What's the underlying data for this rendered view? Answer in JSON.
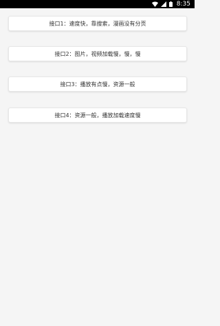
{
  "status_bar": {
    "time": "8:35",
    "icons": [
      "wifi-icon",
      "signal-icon",
      "battery-icon"
    ]
  },
  "api_options": [
    {
      "label": "接口1：速度快，靠搜索，漫画没有分页"
    },
    {
      "label": "接口2：图片，视频加载慢，慢，慢"
    },
    {
      "label": "接口3：播放有点慢，资源一般"
    },
    {
      "label": "接口4：资源一般，播放加载速度慢"
    }
  ]
}
